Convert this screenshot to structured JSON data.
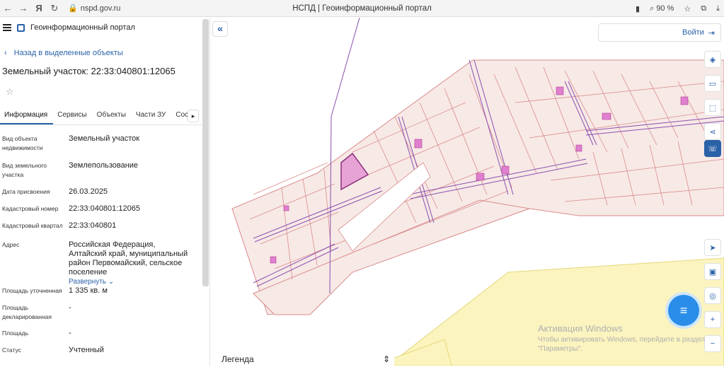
{
  "browser": {
    "url": "nspd.gov.ru",
    "tab_title": "НСПД | Геоинформационный портал",
    "zoom": "90 %",
    "back_icon": "arrow-left-icon",
    "forward_icon": "arrow-right-icon"
  },
  "app": {
    "name": "Геоинформационный портал",
    "back_link": "Назад в выделенные объекты",
    "title": "Земельный участок: 22:33:040801:12065",
    "tabs": [
      "Информация",
      "Сервисы",
      "Объекты",
      "Части ЗУ",
      "Сост"
    ],
    "fields": [
      {
        "label": "Вид объекта недвижимости",
        "value": "Земельный участок"
      },
      {
        "label": "Вид земельного участка",
        "value": "Землепользование"
      },
      {
        "label": "Дата присвоения",
        "value": "26.03.2025"
      },
      {
        "label": "Кадастровый номер",
        "value": "22:33:040801:12065"
      },
      {
        "label": "Кадастровый квартал",
        "value": "22:33:040801"
      },
      {
        "label": "Адрес",
        "value": "Российская Федерация, Алтайский край, муниципальный район Первомайский, сельское поселение"
      },
      {
        "label": "Площадь уточненная",
        "value": "1 335 кв. м"
      },
      {
        "label": "Площадь декларированная",
        "value": "-"
      },
      {
        "label": "Площадь",
        "value": "-"
      },
      {
        "label": "Статус",
        "value": "Учтенный"
      }
    ],
    "expand_label": "Развернуть"
  },
  "map": {
    "login_label": "Войти",
    "legend_label": "Легенда",
    "activation_title": "Активация Windows",
    "activation_text": "Чтобы активировать Windows, перейдите в раздел \"Параметры\".",
    "colors": {
      "parcel_fill": "#f7e9e6",
      "parcel_line": "#d98c8c",
      "road_line": "#8a4fb0",
      "selected_fill": "#e8a3d6",
      "building_fill": "#e07fd0",
      "field_fill": "#fbf4bf",
      "accent": "#2a62a8"
    }
  }
}
